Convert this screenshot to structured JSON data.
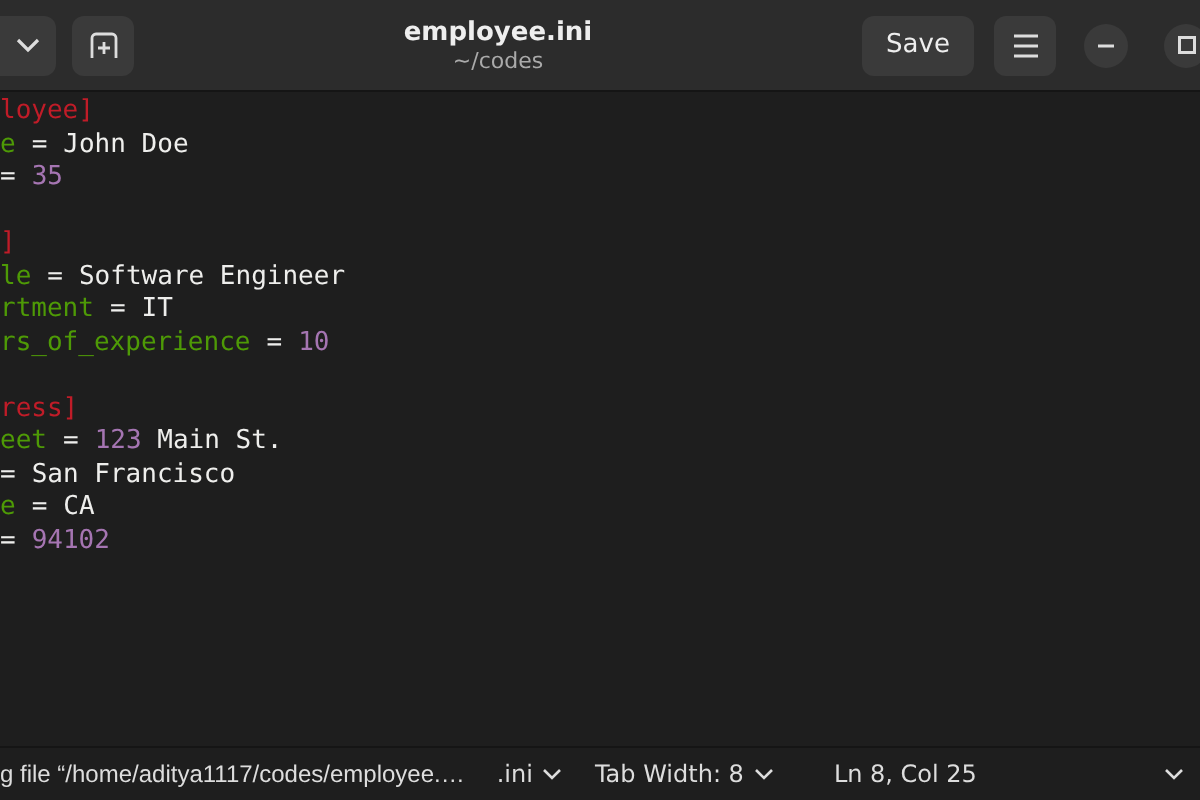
{
  "header": {
    "title": "employee.ini",
    "subtitle": "~/codes",
    "save_label": "Save"
  },
  "lines": [
    {
      "kind": "section",
      "text": "loyee]"
    },
    {
      "kind": "pair",
      "key": "e",
      "sep": "=",
      "parts": [
        {
          "kind": "text",
          "text": "John Doe"
        }
      ]
    },
    {
      "kind": "pair",
      "sep": "=",
      "parts": [
        {
          "kind": "number",
          "text": "35"
        }
      ]
    },
    {
      "kind": "blank"
    },
    {
      "kind": "section",
      "text": "]"
    },
    {
      "kind": "pair",
      "key": "le",
      "sep": "=",
      "parts": [
        {
          "kind": "text",
          "text": "Software Engineer"
        }
      ]
    },
    {
      "kind": "pair",
      "key": "rtment",
      "sep": "=",
      "parts": [
        {
          "kind": "text",
          "text": "IT"
        }
      ]
    },
    {
      "kind": "pair",
      "key": "rs_of_experience",
      "sep": "=",
      "parts": [
        {
          "kind": "number",
          "text": "10"
        }
      ]
    },
    {
      "kind": "blank"
    },
    {
      "kind": "section",
      "text": "ress]"
    },
    {
      "kind": "pair",
      "key": "eet",
      "sep": "=",
      "parts": [
        {
          "kind": "number",
          "text": "123"
        },
        {
          "kind": "text",
          "text": " Main St."
        }
      ]
    },
    {
      "kind": "pair",
      "sep": "=",
      "parts": [
        {
          "kind": "text",
          "text": "San Francisco"
        }
      ]
    },
    {
      "kind": "pair",
      "key": "e",
      "sep": "=",
      "parts": [
        {
          "kind": "text",
          "text": "CA"
        }
      ]
    },
    {
      "kind": "pair",
      "sep": "=",
      "parts": [
        {
          "kind": "number",
          "text": "94102"
        }
      ]
    }
  ],
  "status_bar": {
    "message": "g file “/home/aditya1117/codes/employee.…",
    "language": ".ini",
    "tab_width": "Tab Width: 8",
    "position": "Ln 8, Col 25"
  }
}
